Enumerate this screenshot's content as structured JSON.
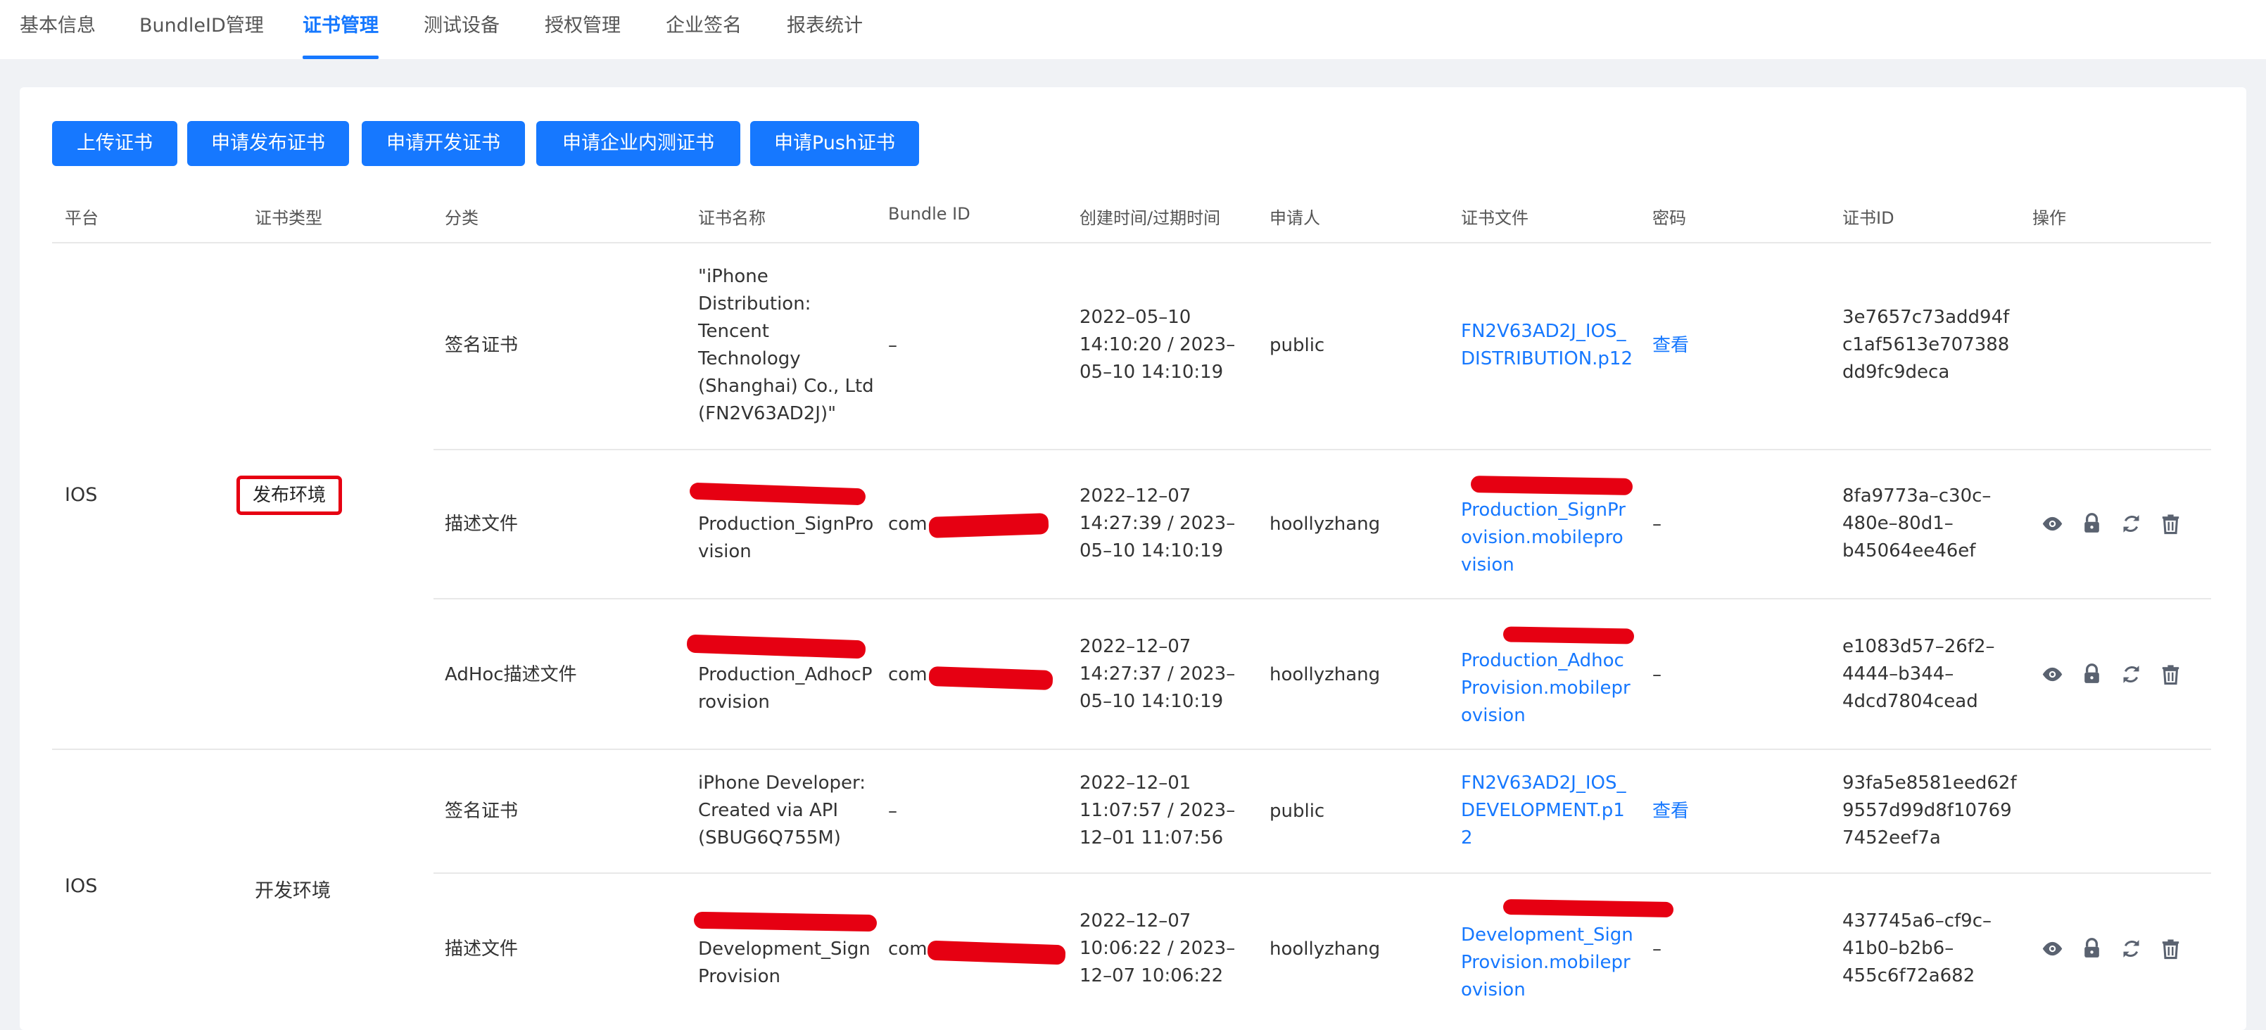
{
  "tabs": [
    {
      "label": "基本信息"
    },
    {
      "label": "BundleID管理"
    },
    {
      "label": "证书管理"
    },
    {
      "label": "测试设备"
    },
    {
      "label": "授权管理"
    },
    {
      "label": "企业签名"
    },
    {
      "label": "报表统计"
    }
  ],
  "active_tab": "证书管理",
  "buttons": {
    "upload": "上传证书",
    "apply_dist": "申请发布证书",
    "apply_dev": "申请开发证书",
    "apply_enterprise": "申请企业内测证书",
    "apply_push": "申请Push证书"
  },
  "columns": [
    "平台",
    "证书类型",
    "分类",
    "证书名称",
    "Bundle ID",
    "创建时间/过期时间",
    "申请人",
    "证书文件",
    "密码",
    "证书ID",
    "操作"
  ],
  "groups": [
    {
      "platform": "IOS",
      "cert_type": "发布环境",
      "rows": [
        {
          "category": "签名证书",
          "cert_name": "\"iPhone Distribution: Tencent Technology (Shanghai) Co., Ltd (FN2V63AD2J)\"",
          "bundle_id": "–",
          "time": "2022–05–10 14:10:20 / 2023–05–10 14:10:19",
          "applicant": "public",
          "file": "FN2V63AD2J_IOS_DISTRIBUTION.p12",
          "password": "查看",
          "cert_id": "3e7657c73add94fc1af5613e707388dd9fc9deca"
        },
        {
          "category": "描述文件",
          "cert_name": "Production_SignProvision",
          "bundle_id": "com.",
          "time": "2022–12–07 14:27:39 / 2023–05–10 14:10:19",
          "applicant": "hoollyzhang",
          "file": "Production_SignProvision.mobileprovision",
          "password": "–",
          "cert_id": "8fa9773a–c30c–480e–80d1–b45064ee46ef"
        },
        {
          "category": "AdHoc描述文件",
          "cert_name": "Production_AdhocProvision",
          "bundle_id": "com.",
          "time": "2022–12–07 14:27:37 / 2023–05–10 14:10:19",
          "applicant": "hoollyzhang",
          "file": "Production_AdhocProvision.mobileprovision",
          "password": "–",
          "cert_id": "e1083d57–26f2–4444–b344–4dcd7804cead"
        }
      ]
    },
    {
      "platform": "IOS",
      "cert_type": "开发环境",
      "rows": [
        {
          "category": "签名证书",
          "cert_name": "iPhone Developer: Created via API (SBUG6Q755M)",
          "bundle_id": "–",
          "time": "2022–12–01 11:07:57 / 2023–12–01 11:07:56",
          "applicant": "public",
          "file": "FN2V63AD2J_IOS_DEVELOPMENT.p12",
          "password": "查看",
          "cert_id": "93fa5e8581eed62f9557d99d8f107697452eef7a"
        },
        {
          "category": "描述文件",
          "cert_name": "Development_SignProvision",
          "bundle_id": "com.",
          "time": "2022–12–07 10:06:22 / 2023–12–07 10:06:22",
          "applicant": "hoollyzhang",
          "file": "Development_SignProvision.mobileprovision",
          "password": "–",
          "cert_id": "437745a6–cf9c–41b0–b2b6–455c6f72a682"
        }
      ]
    }
  ],
  "colors": {
    "accent": "#1678ff",
    "highlight": "#e60012"
  },
  "icons": [
    "eye-icon",
    "lock-icon",
    "refresh-icon",
    "trash-icon"
  ]
}
